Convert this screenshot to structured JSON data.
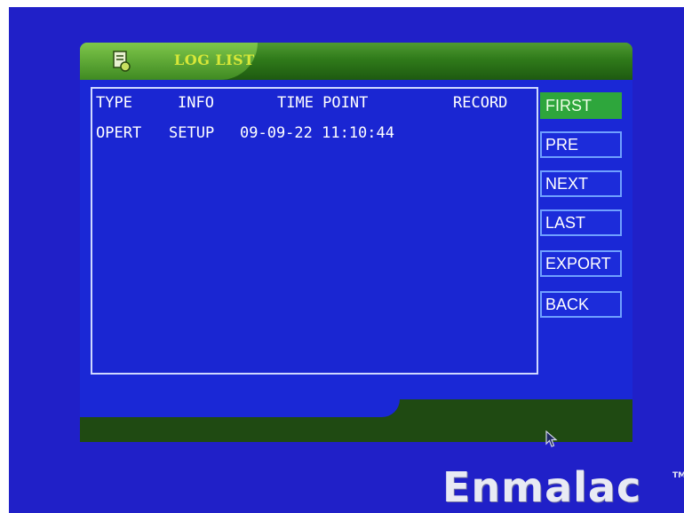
{
  "window": {
    "title": "LOG LIST",
    "icon": "log-document-icon"
  },
  "log_table": {
    "headers": [
      "TYPE",
      "INFO",
      "TIME POINT",
      "RECORD"
    ],
    "rows": [
      {
        "type": "OPERT",
        "info": "SETUP",
        "time_point": "09-09-22 11:10:44",
        "record": ""
      }
    ]
  },
  "buttons": {
    "first": "FIRST",
    "pre": "PRE",
    "next": "NEXT",
    "last": "LAST",
    "export": "EXPORT",
    "back": "BACK"
  },
  "selected_button": "FIRST",
  "brand": {
    "name": "Enmalac",
    "trademark": "TM"
  },
  "colors": {
    "background": "#2020c8",
    "accent_green": "#2ea63c",
    "title_text": "#d8e838"
  }
}
